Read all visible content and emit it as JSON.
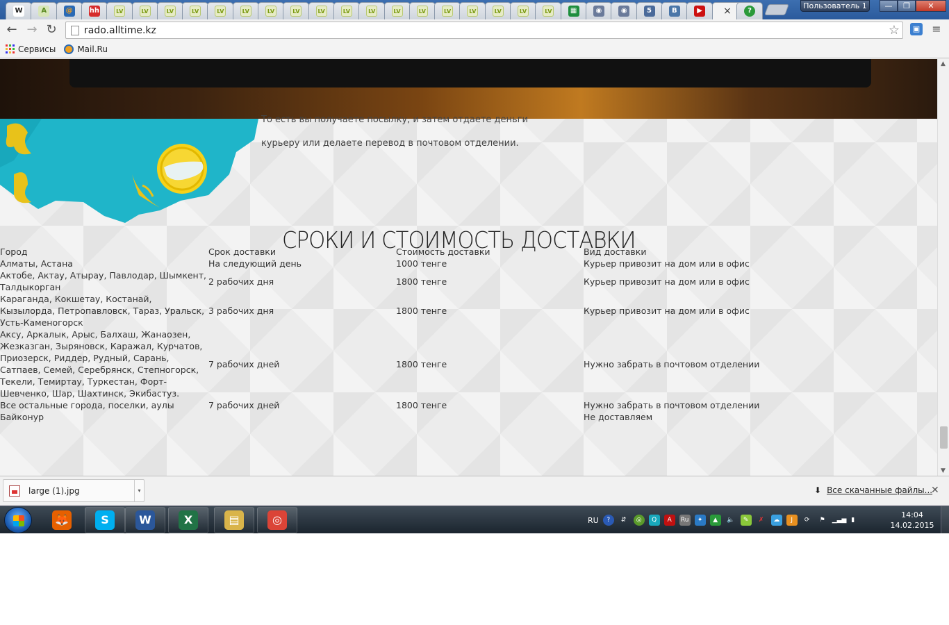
{
  "browser": {
    "profile_name": "Пользователь 1",
    "window_buttons": {
      "minimize": "—",
      "maximize": "❐",
      "close": "✕"
    },
    "active_tab_close": "×",
    "tabs": [
      {
        "icon": "wikipedia-icon",
        "glyph": "W",
        "color": "#ffffff",
        "fg": "#222"
      },
      {
        "icon": "a-logo-icon",
        "glyph": "A",
        "color": "#d8e6b8",
        "fg": "#5a8a20"
      },
      {
        "icon": "mailru-icon",
        "glyph": "@",
        "color": "#2a6ab5",
        "fg": "#f0a020"
      },
      {
        "icon": "hh-icon",
        "glyph": "hh",
        "color": "#d62b2b",
        "fg": "#fff"
      },
      {
        "icon": "lv-icon",
        "glyph": "LV",
        "color": "lv"
      },
      {
        "icon": "lv-icon",
        "glyph": "LV",
        "color": "lv"
      },
      {
        "icon": "lv-icon",
        "glyph": "LV",
        "color": "lv"
      },
      {
        "icon": "lv-icon",
        "glyph": "LV",
        "color": "lv"
      },
      {
        "icon": "lv-icon",
        "glyph": "LV",
        "color": "lv"
      },
      {
        "icon": "lv-icon",
        "glyph": "LV",
        "color": "lv"
      },
      {
        "icon": "lv-icon",
        "glyph": "LV",
        "color": "lv"
      },
      {
        "icon": "lv-icon",
        "glyph": "LV",
        "color": "lv"
      },
      {
        "icon": "lv-icon",
        "glyph": "LV",
        "color": "lv"
      },
      {
        "icon": "lv-icon",
        "glyph": "LV",
        "color": "lv"
      },
      {
        "icon": "lv-icon",
        "glyph": "LV",
        "color": "lv"
      },
      {
        "icon": "lv-icon",
        "glyph": "LV",
        "color": "lv"
      },
      {
        "icon": "lv-icon",
        "glyph": "LV",
        "color": "lv"
      },
      {
        "icon": "lv-icon",
        "glyph": "LV",
        "color": "lv"
      },
      {
        "icon": "lv-icon",
        "glyph": "LV",
        "color": "lv"
      },
      {
        "icon": "lv-icon",
        "glyph": "LV",
        "color": "lv"
      },
      {
        "icon": "lv-icon",
        "glyph": "LV",
        "color": "lv"
      },
      {
        "icon": "lv-icon",
        "glyph": "LV",
        "color": "lv"
      },
      {
        "icon": "sheets-icon",
        "glyph": "▦",
        "color": "#1e8e3e",
        "fg": "#fff"
      },
      {
        "icon": "seal-icon",
        "glyph": "◉",
        "color": "#6a7a9a",
        "fg": "#fff"
      },
      {
        "icon": "seal-icon",
        "glyph": "◉",
        "color": "#6a7a9a",
        "fg": "#fff"
      },
      {
        "icon": "s-icon",
        "glyph": "5",
        "color": "#4a6a9a",
        "fg": "#fff"
      },
      {
        "icon": "vk-icon",
        "glyph": "B",
        "color": "#4a76a8",
        "fg": "#fff"
      },
      {
        "icon": "youtube-icon",
        "glyph": "▶",
        "color": "#cc1010",
        "fg": "#fff"
      }
    ],
    "active_tab": {
      "icon": "blank-page-icon"
    },
    "extra_tab": {
      "icon": "help-icon",
      "glyph": "?",
      "color": "#2a9a3a"
    },
    "url": "rado.alltime.kz",
    "nav": {
      "back": "←",
      "forward": "→",
      "reload": "↻",
      "star": "☆",
      "menu": "≡"
    },
    "bookmarks": [
      {
        "label": "Сервисы",
        "icon": "apps-grid-icon"
      },
      {
        "label": "Mail.Ru",
        "icon": "mailru-icon"
      }
    ]
  },
  "page": {
    "info_line_1": "То есть вы получаете посылку, и затем отдаете деньги",
    "info_line_2": "курьеру или делаете перевод в почтовом отделении.",
    "section_title": "СРОКИ И СТОИМОСТЬ ДОСТАВКИ",
    "table": {
      "headers": [
        "Город",
        "Срок доставки",
        "Стоимость доставки",
        "Вид доставки"
      ],
      "rows": [
        [
          "Алматы, Астана",
          "На следующий день",
          "1000 тенге",
          "Курьер привозит на дом или в офис"
        ],
        [
          "Актобе, Актау, Атырау, Павлодар, Шымкент, Талдыкорган",
          "2 рабочих дня",
          "1800 тенге",
          "Курьер привозит на дом или в офис"
        ],
        [
          "Караганда, Кокшетау, Костанай, Кызылорда, Петропавловск, Тараз, Уральск, Усть-Каменогорск",
          "3 рабочих дня",
          "1800 тенге",
          "Курьер привозит на дом или в офис"
        ],
        [
          "Аксу, Аркалык, Арыс, Балхаш, Жанаозен, Жезказган, Зыряновск, Каражал, Курчатов, Приозерск, Риддер, Рудный, Сарань, Сатпаев, Семей, Серебрянск, Степногорск, Текели, Темиртау, Туркестан, Форт-Шевченко, Шар, Шахтинск, Экибастуз.",
          "7 рабочих дней",
          "1800 тенге",
          "Нужно забрать в почтовом отделении"
        ],
        [
          "Все остальные города, поселки, аулы",
          "7 рабочих дней",
          "1800 тенге",
          "Нужно забрать в почтовом отделении"
        ],
        [
          "Байконур",
          "",
          "",
          "Не доставляем"
        ]
      ]
    }
  },
  "downloads": {
    "file_name": "large (1).jpg",
    "all_downloads": "Все скачанные файлы...",
    "close": "✕",
    "arrow": "▾",
    "dl_icon": "⬇"
  },
  "taskbar": {
    "apps": [
      {
        "name": "firefox",
        "glyph": "🦊",
        "color": "#e66000"
      },
      {
        "name": "skype",
        "glyph": "S",
        "color": "#00aff0"
      },
      {
        "name": "word",
        "glyph": "W",
        "color": "#2b579a"
      },
      {
        "name": "excel",
        "glyph": "X",
        "color": "#217346"
      },
      {
        "name": "explorer",
        "glyph": "▤",
        "color": "#d9b44a"
      },
      {
        "name": "chrome",
        "glyph": "◎",
        "color": "#db4437"
      }
    ],
    "lang": "RU",
    "clock_time": "14:04",
    "clock_date": "14.02.2015",
    "colors": {
      "accent": "#1d5fb5"
    }
  },
  "scrollbar": {
    "position": 0.95
  }
}
